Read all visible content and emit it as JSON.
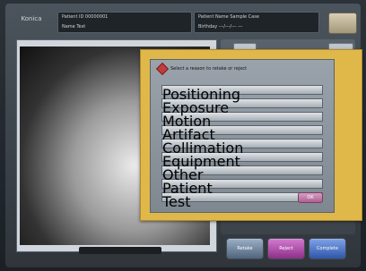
{
  "app": {
    "logo_text": "Konica"
  },
  "header": {
    "left": {
      "row1": "Patient ID  00000001",
      "row2": "Name  Test"
    },
    "right": {
      "row1": "Patient Name  Sample Case",
      "row2": "Birthday  ---/---/---  ---"
    }
  },
  "modal": {
    "title": "Select a reason to retake or reject",
    "options": [
      {
        "label": "Positioning"
      },
      {
        "label": "Exposure"
      },
      {
        "label": "Motion"
      },
      {
        "label": "Artifact"
      },
      {
        "label": "Collimation"
      },
      {
        "label": "Equipment"
      },
      {
        "label": "Other"
      },
      {
        "label": "Patient"
      },
      {
        "label": "Test"
      }
    ],
    "ok_label": "OK"
  },
  "bottom_buttons": [
    {
      "label": "Retake"
    },
    {
      "label": "Reject"
    },
    {
      "label": "Complete"
    }
  ],
  "colors": {
    "modal_border": "#e0b84a",
    "modal_ok": "#b05f92",
    "btn_retake": "#6f86a0",
    "btn_reject": "#b14eaa",
    "btn_complete": "#4a75cf"
  }
}
